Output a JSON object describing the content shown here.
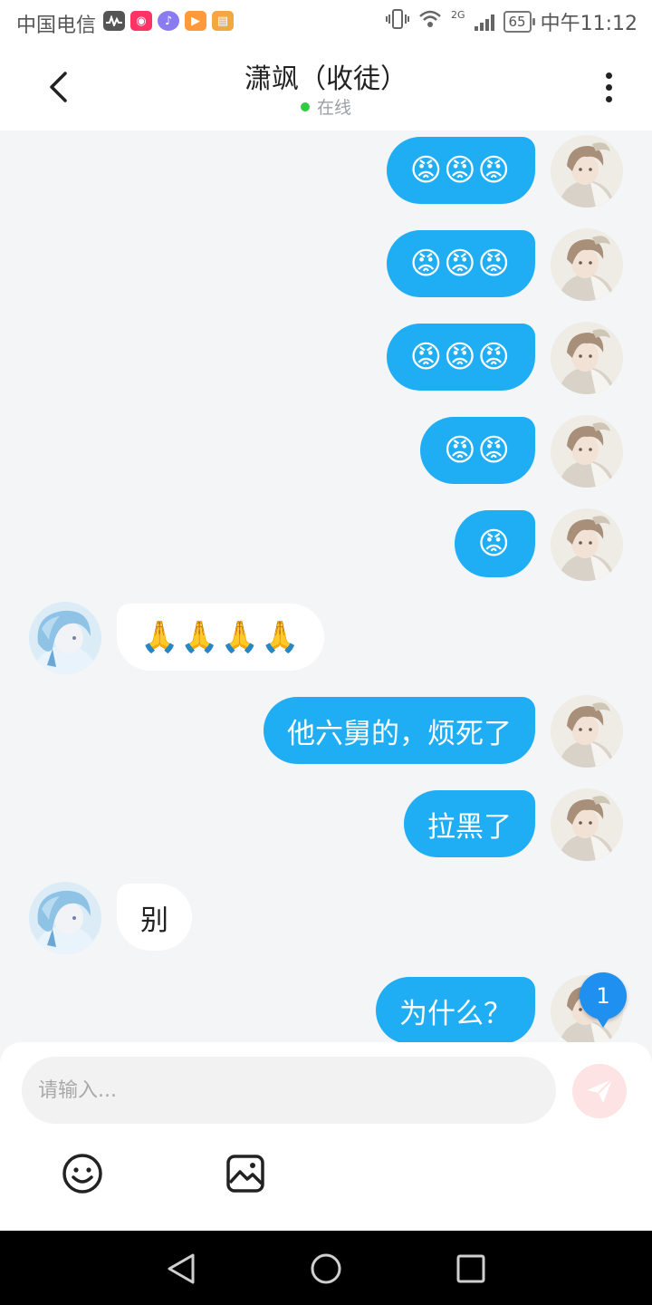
{
  "status_bar": {
    "carrier": "中国电信",
    "network_type": "2G",
    "battery": "65",
    "time": "中午11:12",
    "app_icons": [
      "activity-icon",
      "red-app-icon",
      "music-icon",
      "video-icon",
      "reader-icon"
    ]
  },
  "header": {
    "title": "潇飒（收徒）",
    "status": "在线"
  },
  "messages": [
    {
      "side": "right",
      "text": "😡😡😡"
    },
    {
      "side": "right",
      "text": "😡😡😡"
    },
    {
      "side": "right",
      "text": "😡😡😡"
    },
    {
      "side": "right",
      "text": "😡😡"
    },
    {
      "side": "right",
      "text": "😡"
    },
    {
      "side": "left",
      "text": "🙏🙏🙏🙏"
    },
    {
      "side": "right",
      "text": "他六舅的，烦死了"
    },
    {
      "side": "right",
      "text": "拉黑了"
    },
    {
      "side": "left",
      "text": "别"
    },
    {
      "side": "right",
      "text": "为什么？"
    }
  ],
  "unread_badge": "1",
  "composer": {
    "placeholder": "请输入..."
  },
  "colors": {
    "outgoing_bubble": "#1faef3",
    "incoming_bubble": "#ffffff",
    "online_dot": "#2ecc40",
    "badge": "#1f8ff0"
  }
}
